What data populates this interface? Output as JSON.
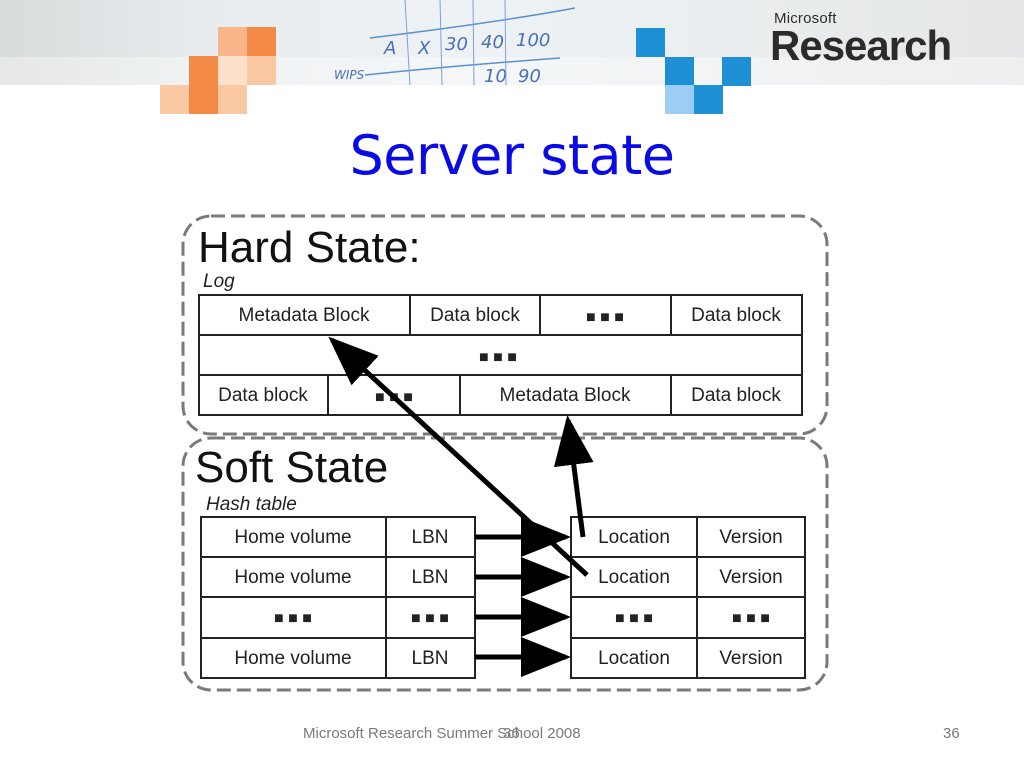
{
  "header": {
    "brand_small": "Microsoft",
    "brand_big": "Research",
    "scribbles": [
      "A",
      "X",
      "30",
      "40",
      "100",
      "10",
      "90",
      "WIPS"
    ]
  },
  "slide": {
    "title": "Server state"
  },
  "diagram": {
    "hard_state": {
      "heading": "Hard State:",
      "subheading": "Log",
      "rows": [
        [
          "Metadata Block",
          "Data block",
          "■ ■ ■",
          "Data block"
        ],
        [
          "■ ■ ■"
        ],
        [
          "Data block",
          "■ ■ ■",
          "Metadata Block",
          "Data block"
        ]
      ]
    },
    "soft_state": {
      "heading": "Soft State",
      "subheading": "Hash table",
      "key_rows": [
        [
          "Home volume",
          "LBN"
        ],
        [
          "Home volume",
          "LBN"
        ],
        [
          "■ ■ ■",
          "■ ■ ■"
        ],
        [
          "Home volume",
          "LBN"
        ]
      ],
      "value_rows": [
        [
          "Location",
          "Version"
        ],
        [
          "Location",
          "Version"
        ],
        [
          "■ ■ ■",
          "■ ■ ■"
        ],
        [
          "Location",
          "Version"
        ]
      ]
    },
    "arrows": [
      {
        "from": "soft.value_rows.1.location",
        "to": "hard.rows.0.metadata_block"
      },
      {
        "from": "soft.value_rows.0.location",
        "to": "hard.rows.2.metadata_block"
      },
      {
        "from": "soft.key_rows.0",
        "to": "soft.value_rows.0"
      },
      {
        "from": "soft.key_rows.1",
        "to": "soft.value_rows.1"
      },
      {
        "from": "soft.key_rows.2",
        "to": "soft.value_rows.2"
      },
      {
        "from": "soft.key_rows.3",
        "to": "soft.value_rows.3"
      }
    ]
  },
  "footer": {
    "text": "Microsoft Research Summer School 2008",
    "overlay_number": "36",
    "page_number": "36"
  }
}
